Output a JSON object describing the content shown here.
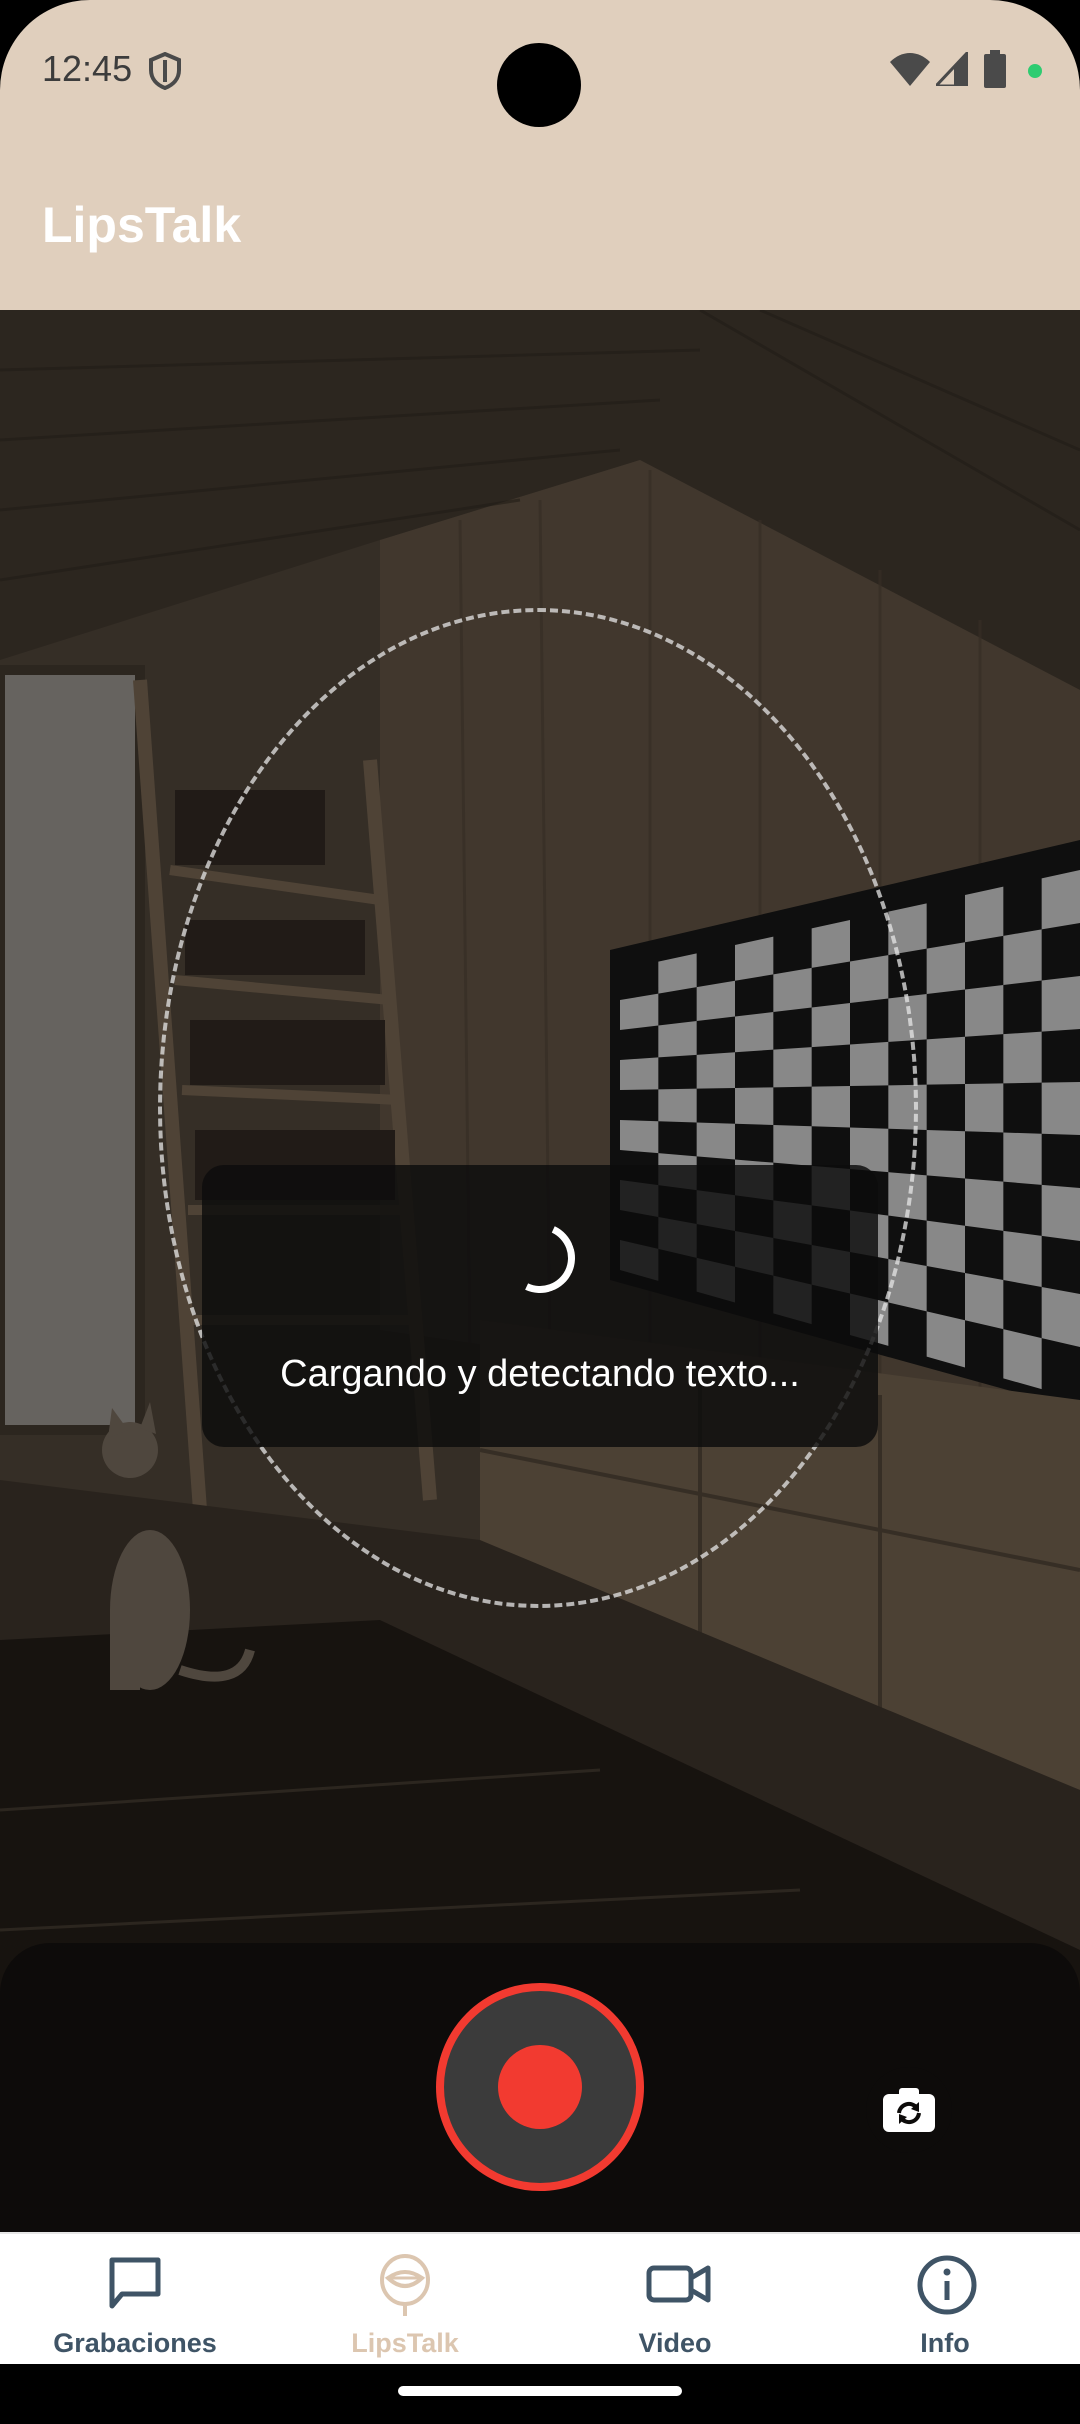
{
  "status_bar": {
    "time": "12:45",
    "icons": [
      "shield-icon",
      "wifi-icon",
      "signal-icon",
      "battery-icon",
      "privacy-dot"
    ]
  },
  "app_bar": {
    "title": "LipsTalk"
  },
  "preview": {
    "loading_text": "Cargando y detectando texto...",
    "spinner_icon": "spinner-icon"
  },
  "controls": {
    "record_icon": "record-icon",
    "record_color": "#f23a30",
    "flip_icon": "flip-camera-icon"
  },
  "bottom_nav": {
    "items": [
      {
        "label": "Grabaciones",
        "icon": "chat-bubble-icon",
        "active": false
      },
      {
        "label": "LipsTalk",
        "icon": "lips-icon",
        "active": true
      },
      {
        "label": "Video",
        "icon": "video-camera-icon",
        "active": false
      },
      {
        "label": "Info",
        "icon": "info-icon",
        "active": false
      }
    ],
    "active_color": "#dcc6b0",
    "inactive_color": "#3f5466"
  },
  "colors": {
    "app_bar": "#e0cfbd"
  }
}
